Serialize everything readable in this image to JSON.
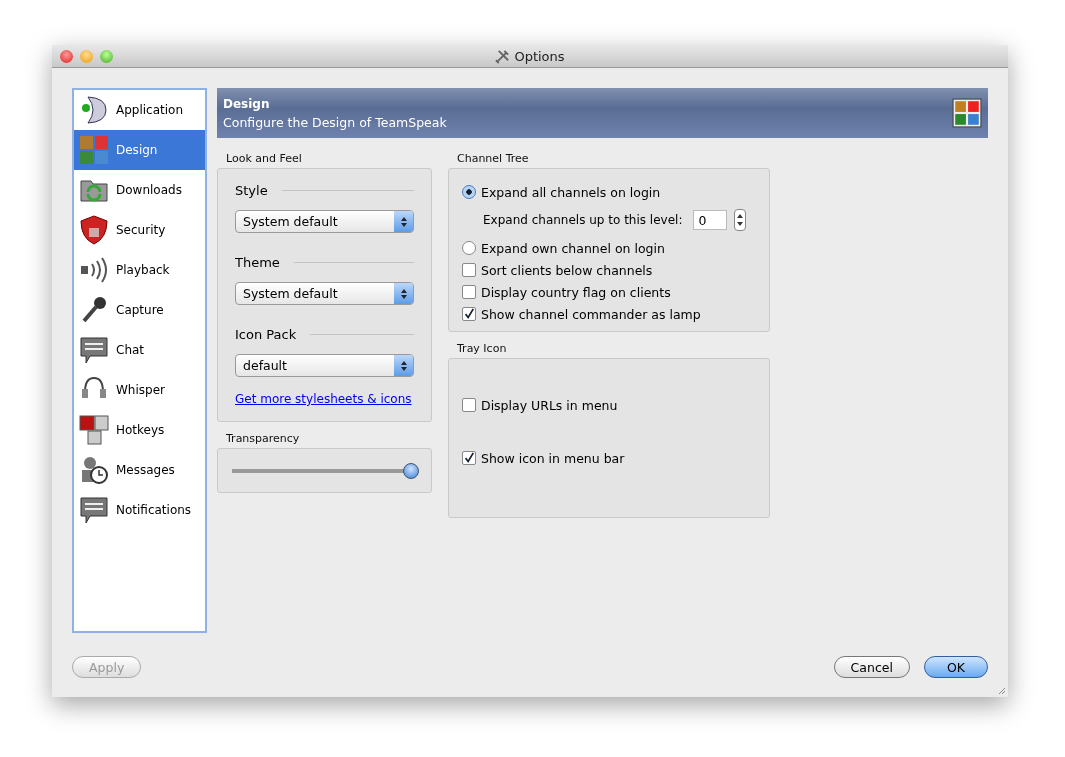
{
  "window": {
    "title": "Options"
  },
  "sidebar": {
    "items": [
      {
        "label": "Application",
        "selected": false
      },
      {
        "label": "Design",
        "selected": true
      },
      {
        "label": "Downloads",
        "selected": false
      },
      {
        "label": "Security",
        "selected": false
      },
      {
        "label": "Playback",
        "selected": false
      },
      {
        "label": "Capture",
        "selected": false
      },
      {
        "label": "Chat",
        "selected": false
      },
      {
        "label": "Whisper",
        "selected": false
      },
      {
        "label": "Hotkeys",
        "selected": false
      },
      {
        "label": "Messages",
        "selected": false
      },
      {
        "label": "Notifications",
        "selected": false
      }
    ]
  },
  "header": {
    "title": "Design",
    "subtitle": "Configure the Design of TeamSpeak"
  },
  "look_and_feel": {
    "title": "Look and Feel",
    "selects": [
      {
        "label": "Style",
        "value": "System default"
      },
      {
        "label": "Theme",
        "value": "System default"
      },
      {
        "label": "Icon Pack",
        "value": "default"
      }
    ],
    "link": "Get more stylesheets & icons"
  },
  "transparency": {
    "title": "Transparency",
    "level": 0.97
  },
  "channel_tree": {
    "title": "Channel Tree",
    "options": [
      {
        "kind": "radio",
        "label": "Expand all channels on login",
        "selected": true
      },
      {
        "kind": "spinner",
        "label": "Expand channels up to this level:",
        "value": "0"
      },
      {
        "kind": "radio",
        "label": "Expand own channel on login",
        "selected": false
      },
      {
        "kind": "checkbox",
        "label": "Sort clients below channels",
        "checked": false
      },
      {
        "kind": "checkbox",
        "label": "Display country flag on clients",
        "checked": false
      },
      {
        "kind": "checkbox",
        "label": "Show channel commander as lamp",
        "checked": true
      }
    ]
  },
  "tray_icon": {
    "title": "Tray Icon",
    "options": [
      {
        "label": "Display URLs in menu",
        "checked": false
      },
      {
        "label": "Show icon in menu bar",
        "checked": true
      }
    ]
  },
  "buttons": [
    {
      "label": "Apply",
      "disabled": true,
      "default": false
    },
    {
      "label": "Cancel",
      "disabled": false,
      "default": false
    },
    {
      "label": "OK",
      "disabled": false,
      "default": true
    }
  ]
}
